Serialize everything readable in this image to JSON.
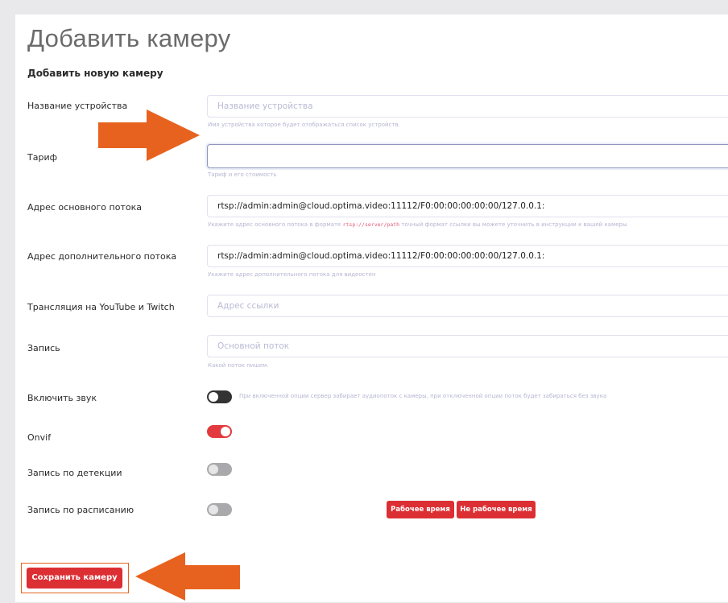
{
  "page": {
    "title": "Добавить камеру",
    "subtitle": "Добавить новую камеру"
  },
  "fields": {
    "device_name": {
      "label": "Название устройства",
      "placeholder": "Название устройства",
      "value": "",
      "hint": "Имя устройства которое будет отображаться список устройств."
    },
    "tariff": {
      "label": "Тариф",
      "value": "",
      "hint": "Тариф и его стоимость"
    },
    "main_stream": {
      "label": "Адрес основного потока",
      "value": "rtsp://admin:admin@cloud.optima.video:11112/F0:00:00:00:00:00/127.0.0.1:",
      "hint_before": "Укажите адрес основного потока в формате",
      "hint_code": "rtsp://server/path",
      "hint_after": "точный формат ссылки вы можете уточнить в инструкции к вашей камеры"
    },
    "extra_stream": {
      "label": "Адрес дополнительного потока",
      "value": "rtsp://admin:admin@cloud.optima.video:11112/F0:00:00:00:00:00/127.0.0.1:",
      "hint": "Укажите адрес дополнительного потока для видеостен"
    },
    "broadcast": {
      "label": "Трансляция на YouTube и Twitch",
      "placeholder": "Адрес ссылки",
      "value": ""
    },
    "recording": {
      "label": "Запись",
      "value": "Основной поток",
      "hint": "Какой поток пишем."
    }
  },
  "toggles": {
    "sound": {
      "label": "Включить звук",
      "on": false,
      "hint": "При включенной опции сервер забирает аудиопоток с камеры, при отключенной опции поток будет забираться без звука"
    },
    "onvif": {
      "label": "Onvif",
      "on": true
    },
    "detection": {
      "label": "Запись по детекции",
      "on": false
    },
    "schedule": {
      "label": "Запись по расписанию",
      "on": false
    }
  },
  "schedule_buttons": {
    "work_time": "Рабочее время",
    "non_work_time": "Не рабочее время"
  },
  "actions": {
    "save_label": "Сохранить камеру"
  },
  "colors": {
    "accent_red": "#dc2f34",
    "annotation_orange": "#e8621f",
    "toggle_on": "#e23a3e",
    "toggle_dark": "#333333",
    "toggle_off": "#a9a9ab",
    "hint_text": "#b6b6d2"
  },
  "annotations": {
    "arrow_to_field": "arrow-right-icon",
    "arrow_to_save": "arrow-left-icon"
  }
}
